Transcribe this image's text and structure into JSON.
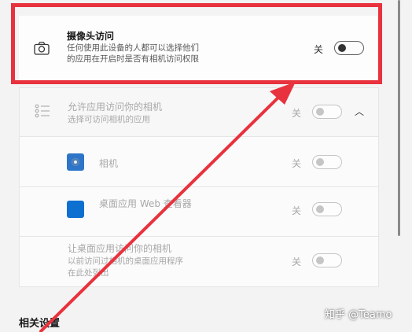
{
  "camera_access": {
    "title": "摄像头访问",
    "desc_line1": "任何使用此设备的人都可以选择他们",
    "desc_line2": "的应用在开启时是否有相机访问权限",
    "state": "关",
    "icon": "camera-icon"
  },
  "allow_apps": {
    "title": "允许应用访问你的相机",
    "desc": "选择可访问相机的应用",
    "state": "关",
    "icon": "list-icon"
  },
  "apps": [
    {
      "name": "相机",
      "state": "关",
      "icon": "camera-app-icon"
    },
    {
      "name": "桌面应用 Web 查看器",
      "state": "关",
      "icon": "store-app-icon"
    }
  ],
  "desktop_access": {
    "title": "让桌面应用访问你的相机",
    "desc_line1": "以前访问过相机的桌面应用程序",
    "desc_line2": "在此处列出",
    "state": "关"
  },
  "related_settings": {
    "title": "相关设置"
  },
  "watermark": "知乎 @Teamo",
  "colors": {
    "highlight": "#e8323d",
    "accent_blue": "#0d6fd0"
  }
}
